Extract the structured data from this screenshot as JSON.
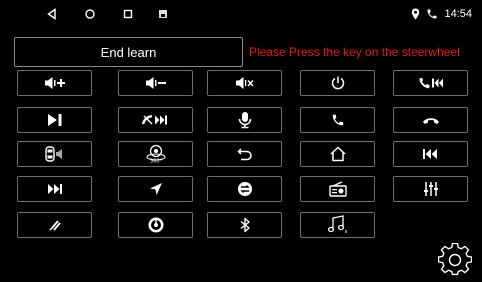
{
  "status_bar": {
    "time": "14:54",
    "nav_icons": [
      "back-icon",
      "home-icon",
      "recent-apps-icon",
      "screenshot-icon"
    ],
    "status_icons": [
      "location-icon",
      "phone-icon"
    ]
  },
  "header": {
    "end_learn_label": "End learn",
    "prompt_text": "Please Press the key on the steerwheel",
    "prompt_color": "#e01818"
  },
  "keys": [
    {
      "row": 1,
      "col": 1,
      "icon": "volume-up-icon"
    },
    {
      "row": 1,
      "col": 2,
      "icon": "volume-down-icon"
    },
    {
      "row": 1,
      "col": 3,
      "icon": "mute-icon"
    },
    {
      "row": 1,
      "col": 4,
      "icon": "power-icon"
    },
    {
      "row": 1,
      "col": 5,
      "icon": "call-previous-icon"
    },
    {
      "row": 2,
      "col": 1,
      "icon": "play-pause-icon"
    },
    {
      "row": 2,
      "col": 2,
      "icon": "hangup-next-icon"
    },
    {
      "row": 2,
      "col": 3,
      "icon": "microphone-icon"
    },
    {
      "row": 2,
      "col": 4,
      "icon": "phone-answer-icon"
    },
    {
      "row": 2,
      "col": 5,
      "icon": "phone-hangup-icon"
    },
    {
      "row": 3,
      "col": 1,
      "icon": "car-speaker-icon"
    },
    {
      "row": 3,
      "col": 2,
      "icon": "camera-360-icon"
    },
    {
      "row": 3,
      "col": 3,
      "icon": "return-icon"
    },
    {
      "row": 3,
      "col": 4,
      "icon": "home-icon"
    },
    {
      "row": 3,
      "col": 5,
      "icon": "previous-track-icon"
    },
    {
      "row": 4,
      "col": 1,
      "icon": "next-track-icon"
    },
    {
      "row": 4,
      "col": 2,
      "icon": "navigation-icon"
    },
    {
      "row": 4,
      "col": 3,
      "icon": "mode-switch-icon"
    },
    {
      "row": 4,
      "col": 4,
      "icon": "radio-icon"
    },
    {
      "row": 4,
      "col": 5,
      "icon": "equalizer-icon"
    },
    {
      "row": 5,
      "col": 1,
      "icon": "mute-microphone-icon"
    },
    {
      "row": 5,
      "col": 2,
      "icon": "steering-wheel-icon"
    },
    {
      "row": 5,
      "col": 3,
      "icon": "bluetooth-icon"
    },
    {
      "row": 5,
      "col": 4,
      "icon": "music-icon"
    }
  ],
  "settings_icon": "gear-icon",
  "colors": {
    "background": "#000000",
    "key_border": "#6e6e6e",
    "text": "#ffffff"
  }
}
